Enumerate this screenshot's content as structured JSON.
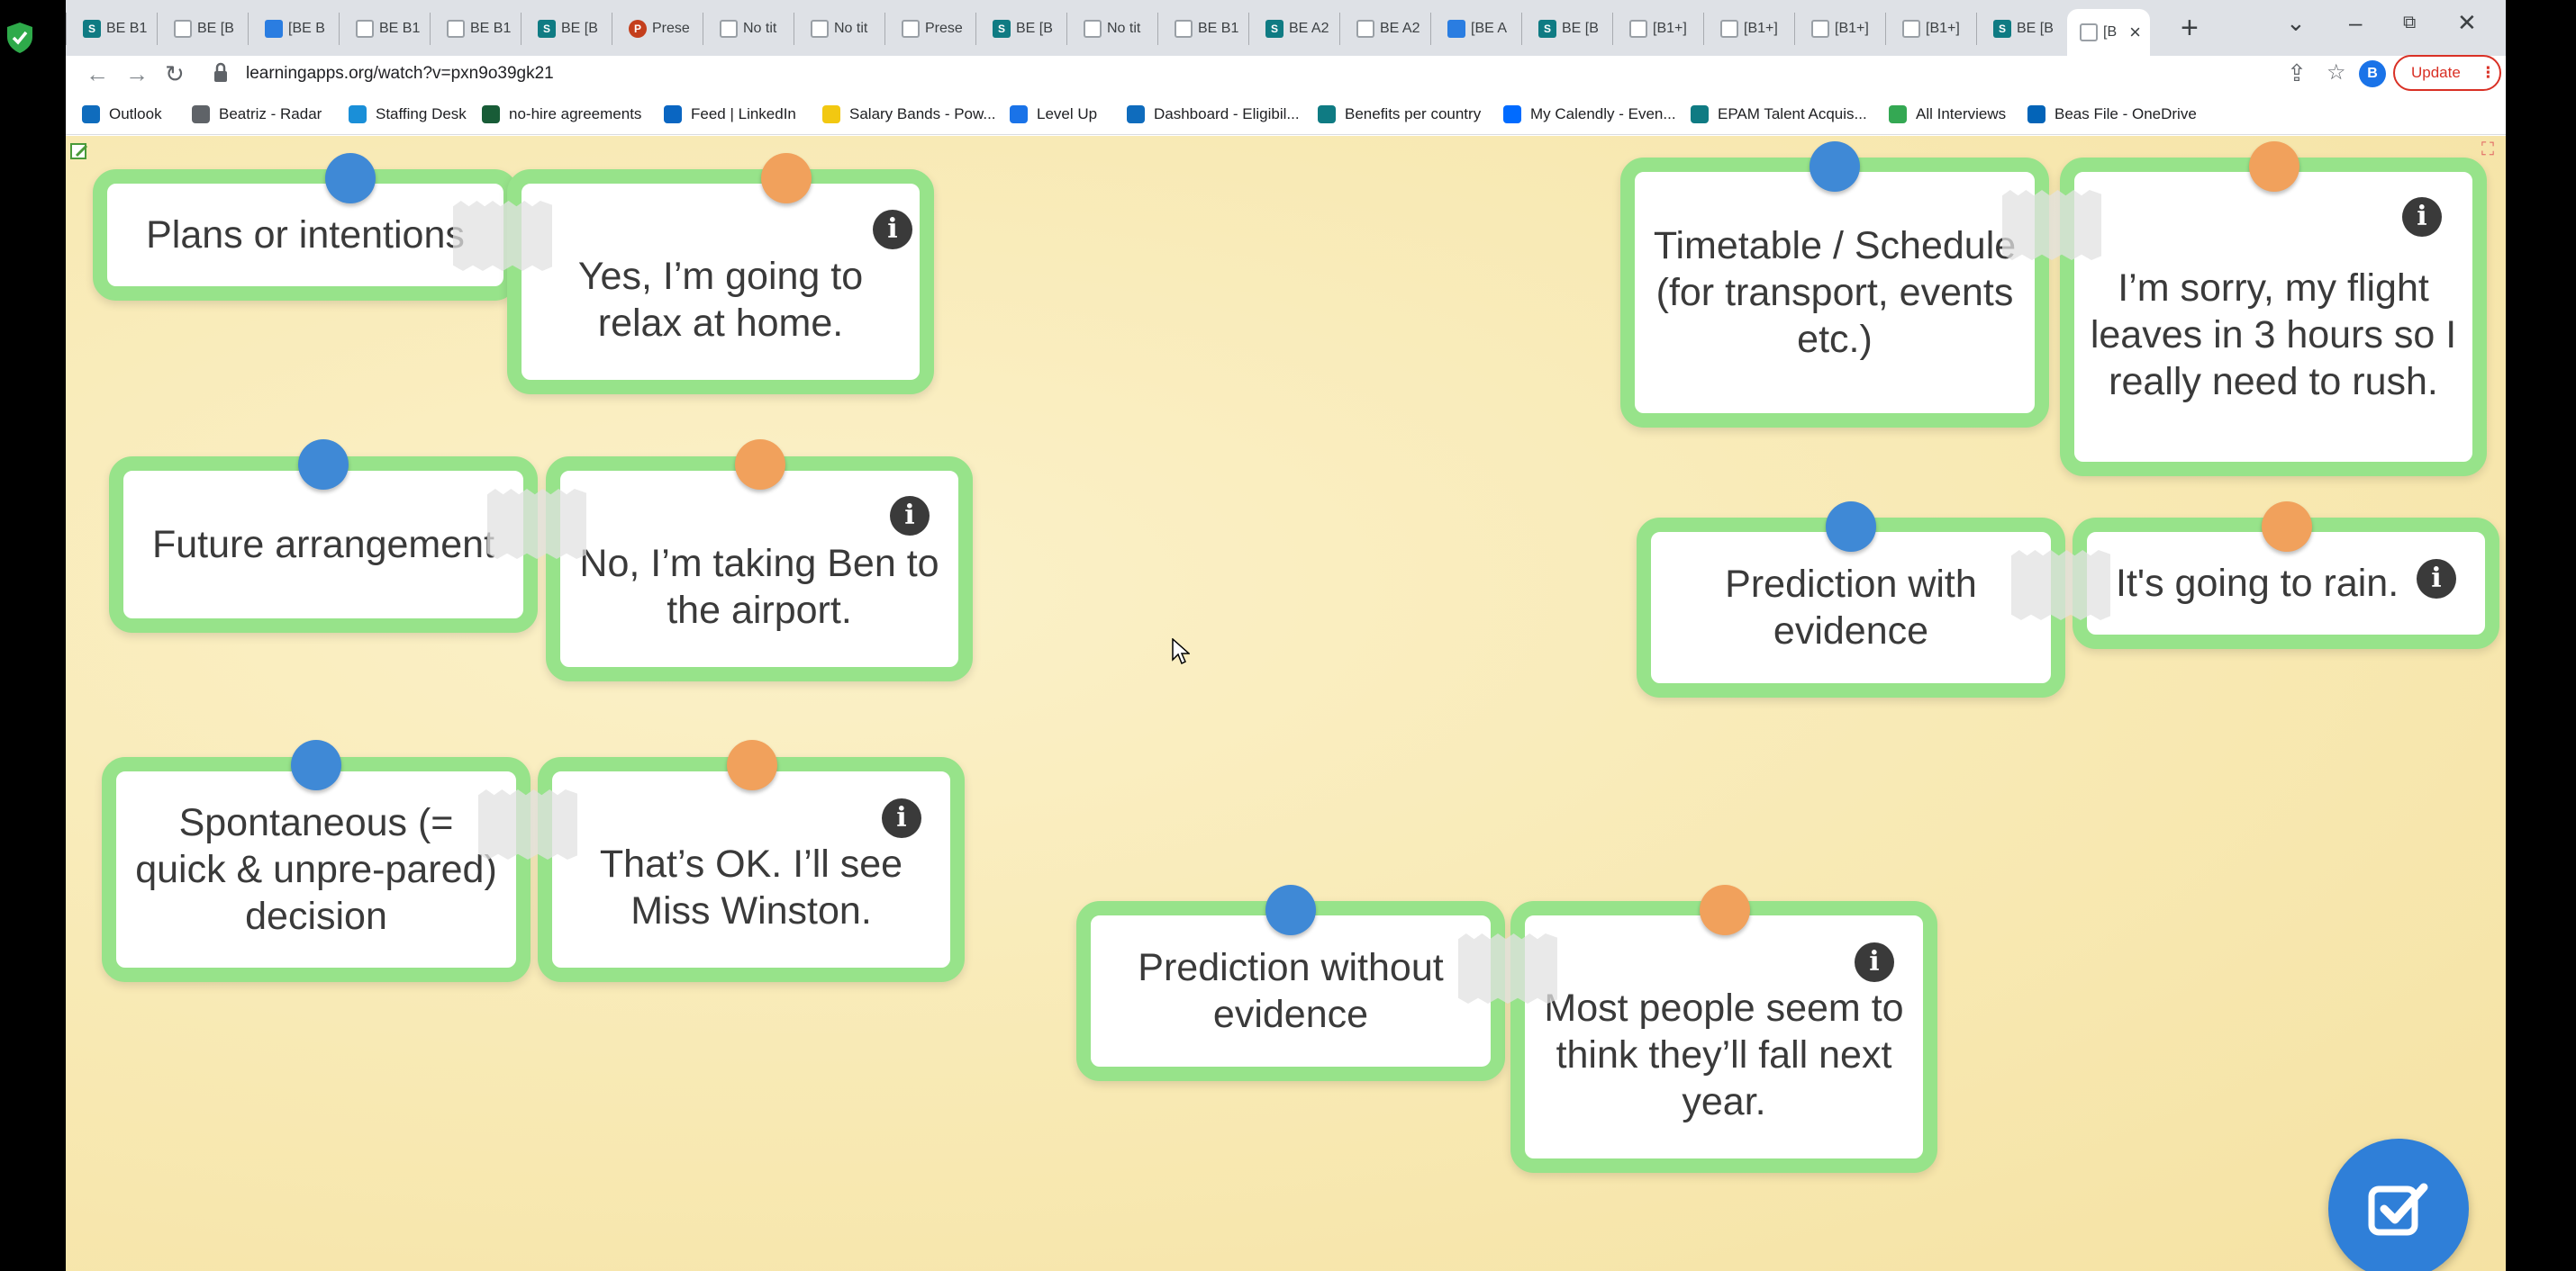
{
  "browser": {
    "url": "learningapps.org/watch?v=pxn9o39gk21",
    "tabs": [
      {
        "label": "BE B1",
        "icon": "sharepoint-icon"
      },
      {
        "label": "BE [B",
        "icon": "page-icon"
      },
      {
        "label": "[BE B",
        "icon": "puzzle-icon"
      },
      {
        "label": "BE B1",
        "icon": "page-icon"
      },
      {
        "label": "BE B1",
        "icon": "page-icon"
      },
      {
        "label": "BE [B",
        "icon": "sharepoint-icon"
      },
      {
        "label": "Prese",
        "icon": "powerpoint-icon"
      },
      {
        "label": "No tit",
        "icon": "page-icon"
      },
      {
        "label": "No tit",
        "icon": "page-icon"
      },
      {
        "label": "Prese",
        "icon": "page-icon"
      },
      {
        "label": "BE [B",
        "icon": "sharepoint-icon"
      },
      {
        "label": "No tit",
        "icon": "page-icon"
      },
      {
        "label": "BE B1",
        "icon": "page-icon"
      },
      {
        "label": "BE A2",
        "icon": "sharepoint-icon"
      },
      {
        "label": "BE A2",
        "icon": "page-icon"
      },
      {
        "label": "[BE A",
        "icon": "puzzle-icon"
      },
      {
        "label": "BE [B",
        "icon": "sharepoint-icon"
      },
      {
        "label": "[B1+]",
        "icon": "page-icon"
      },
      {
        "label": "[B1+]",
        "icon": "page-icon"
      },
      {
        "label": "[B1+]",
        "icon": "page-icon"
      },
      {
        "label": "[B1+]",
        "icon": "page-icon"
      },
      {
        "label": "BE [B",
        "icon": "sharepoint-icon"
      },
      {
        "label": "[B",
        "icon": "page-icon",
        "active": true
      }
    ],
    "update_label": "Update",
    "avatar_letter": "B",
    "bookmarks": [
      {
        "label": "Outlook",
        "color": "#0f6cbd"
      },
      {
        "label": "Beatriz - Radar",
        "color": "#5f6368"
      },
      {
        "label": "Staffing Desk",
        "color": "#1a8fd8"
      },
      {
        "label": "no-hire agreements",
        "color": "#185c37"
      },
      {
        "label": "Feed | LinkedIn",
        "color": "#0a66c2"
      },
      {
        "label": "Salary Bands - Pow...",
        "color": "#f2c811"
      },
      {
        "label": "Level Up",
        "color": "#1a73e8"
      },
      {
        "label": "Dashboard - Eligibil...",
        "color": "#0f6cbd"
      },
      {
        "label": "Benefits per country",
        "color": "#0f7b83"
      },
      {
        "label": "My Calendly - Even...",
        "color": "#006bff"
      },
      {
        "label": "EPAM Talent Acquis...",
        "color": "#0f7b83"
      },
      {
        "label": "All Interviews",
        "color": "#34a853"
      },
      {
        "label": "Beas File - OneDrive",
        "color": "#0364b8"
      }
    ]
  },
  "app": {
    "pairs": [
      {
        "left": "Plans or intentions",
        "right": "Yes, I’m going to relax at home."
      },
      {
        "left": "Future arrangement",
        "right": "No, I’m taking Ben to the airport."
      },
      {
        "left": "Spontaneous (= quick & unpre-pared) decision",
        "right": "That’s OK. I’ll see Miss Winston."
      },
      {
        "left": "Prediction without evidence",
        "right": "Most people seem to think they’ll fall next year."
      },
      {
        "left": "Timetable / Schedule (for transport, events etc.)",
        "right": "I’m sorry, my flight leaves in 3 hours so I really need to rush."
      },
      {
        "left": "Prediction with evidence",
        "right": "It's going to rain."
      }
    ],
    "colors": {
      "card_border": "#97e38a",
      "pin_blue": "#3f89d6",
      "pin_orange": "#f1a15c",
      "check_button": "#2f7fd8"
    }
  }
}
